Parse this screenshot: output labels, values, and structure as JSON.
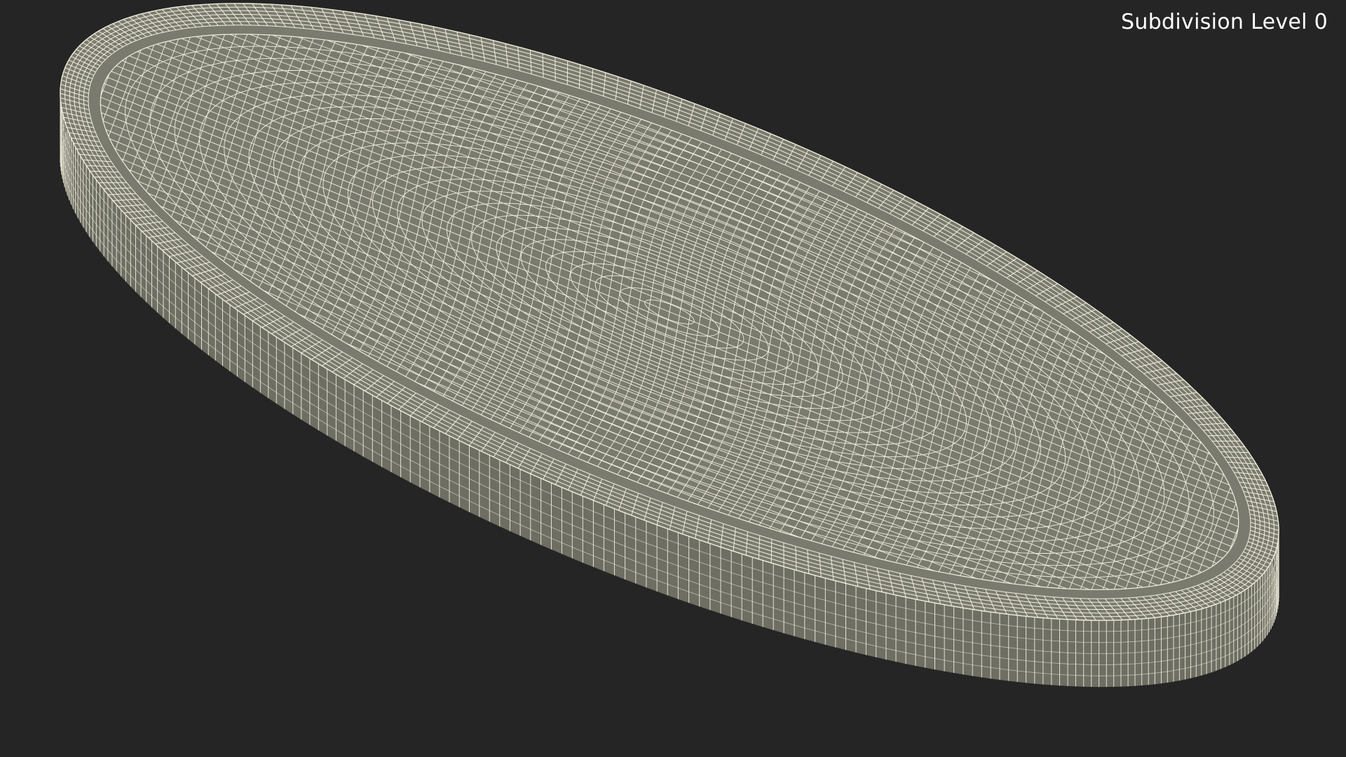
{
  "viewport": {
    "subdivision_label": "Subdivision Level 0",
    "background_color": "#252525",
    "mesh_fill_color": "#7a7a6e",
    "mesh_fill_dark_color": "#6e6e63",
    "wire_color": "#f2efdc"
  }
}
